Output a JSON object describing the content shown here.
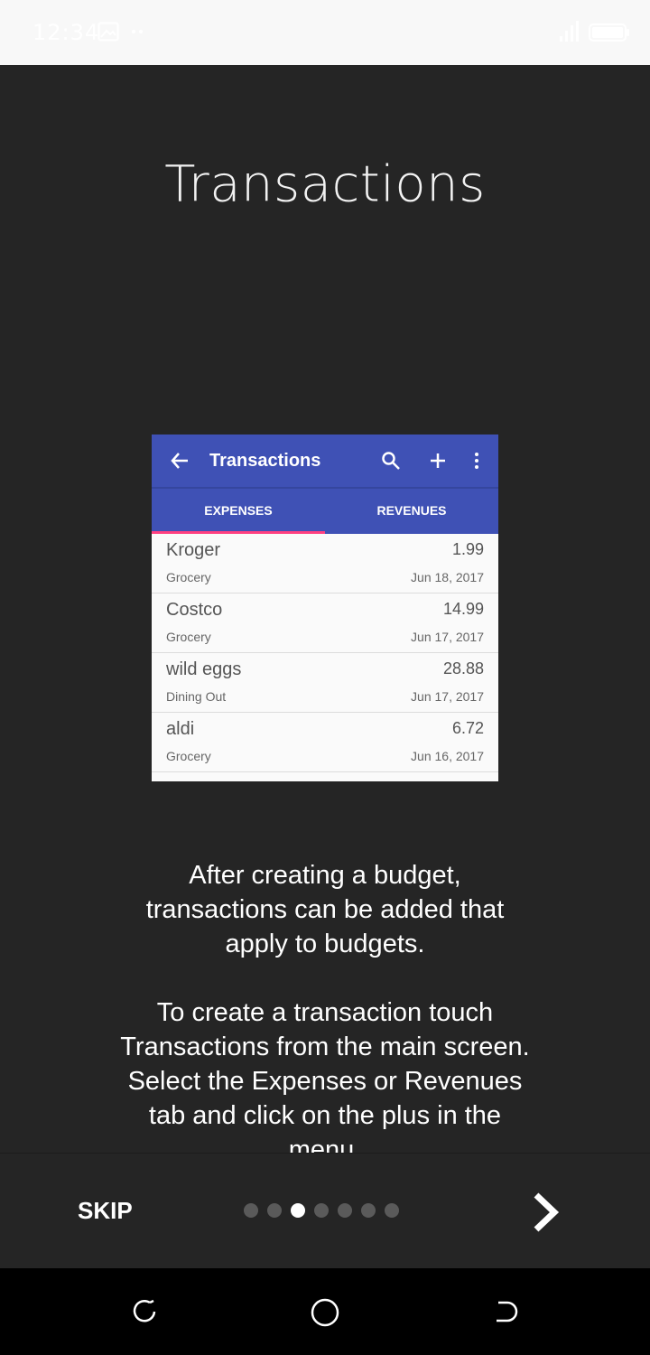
{
  "status_bar": {
    "time": "12:34",
    "image_icon": "image-icon",
    "more_icon": "more-horizontal-icon",
    "signal_icon": "signal-icon",
    "battery_icon": "battery-icon"
  },
  "title": "Transactions",
  "preview": {
    "app_bar_title": "Transactions",
    "tabs": [
      "EXPENSES",
      "REVENUES"
    ],
    "accent": "#3f51b5",
    "indicator_color": "#ff4081",
    "items": [
      {
        "name": "Kroger",
        "amount": "1.99",
        "category": "Grocery",
        "date": "Jun 18, 2017"
      },
      {
        "name": "Costco",
        "amount": "14.99",
        "category": "Grocery",
        "date": "Jun 17, 2017"
      },
      {
        "name": "wild eggs",
        "amount": "28.88",
        "category": "Dining Out",
        "date": "Jun 17, 2017"
      },
      {
        "name": "aldi",
        "amount": "6.72",
        "category": "Grocery",
        "date": "Jun 16, 2017"
      }
    ]
  },
  "description": {
    "paragraph1": "After creating a budget, transactions can be added that apply to budgets.",
    "paragraph2": "To create a transaction touch Transactions from the main screen. Select the Expenses or Revenues tab and click on the plus in the menu."
  },
  "intro_nav": {
    "skip_label": "SKIP",
    "page_count": 7,
    "active_page": 3
  }
}
